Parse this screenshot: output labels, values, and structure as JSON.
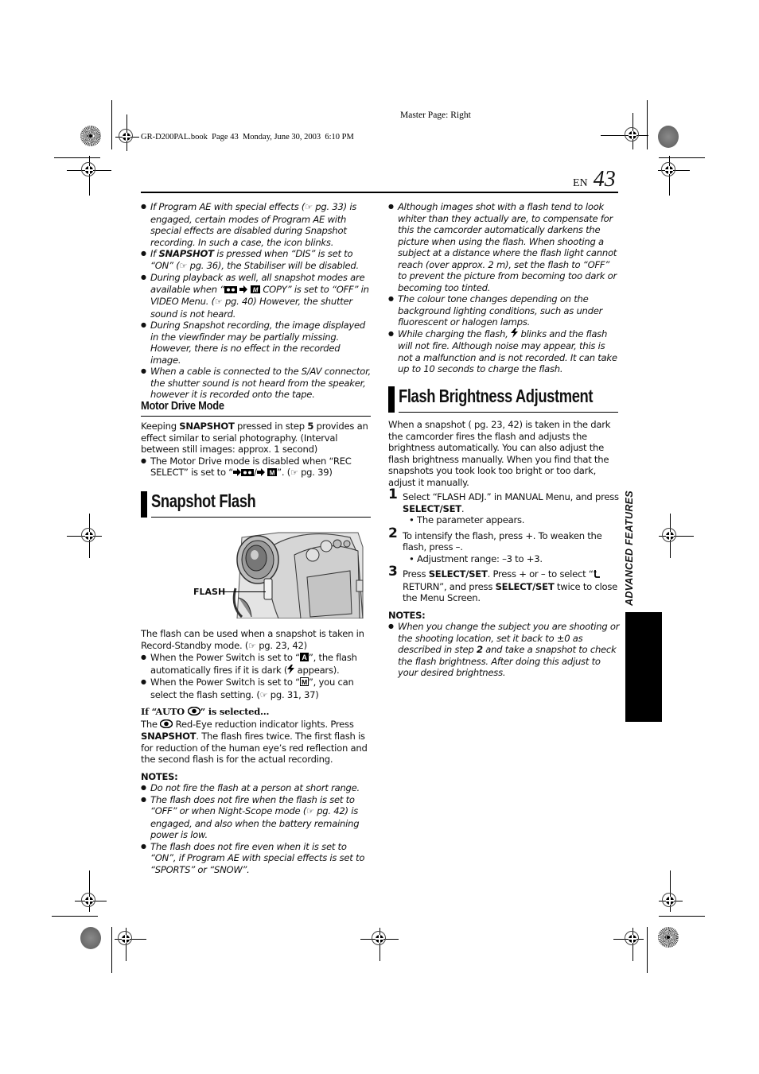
{
  "header": {
    "master_page": "Master Page: Right",
    "book_info": "GR-D200PAL.book  Page 43  Monday, June 30, 2003  6:10 PM",
    "lang": "EN",
    "page_number": "43"
  },
  "side_tab": {
    "label": "ADVANCED FEATURES"
  },
  "left_column": {
    "intro_bullets": [
      {
        "pre": "If Program AE with special effects (",
        "ref": "pg. 33) is engaged, certain modes of Program AE with special effects are disabled during Snapshot recording. In such a case, the icon blinks."
      },
      {
        "pre": "If ",
        "bold": "SNAPSHOT",
        "post": " is pressed when “DIS” is set to “ON” (",
        "ref": "pg. 36), the Stabiliser will be disabled."
      },
      {
        "pre": "During playback as well, all snapshot modes are available when “",
        "mid": " COPY” is set to “OFF” in VIDEO Menu. (",
        "ref": "pg. 40) However, the shutter sound is not heard."
      },
      {
        "text": "During Snapshot recording, the image displayed in the viewfinder may be partially missing. However, there is no effect in the recorded image."
      },
      {
        "text": "When a cable is connected to the S/AV connector, the shutter sound is not heard from the speaker, however it is recorded onto the tape."
      }
    ],
    "motor_drive": {
      "title": "Motor Drive Mode",
      "body_pre": "Keeping ",
      "body_bold": "SNAPSHOT",
      "body_mid": " pressed in step ",
      "body_step": "5",
      "body_post": " provides an effect similar to serial photography. (Interval between still images: approx. 1 second)",
      "bullet_pre": "The Motor Drive mode is disabled when “REC SELECT” is set to “",
      "bullet_post": "”. (",
      "bullet_ref": "pg. 39)"
    },
    "snapshot_flash": {
      "title": "Snapshot Flash",
      "figure_label": "FLASH",
      "body": "The flash can be used when a snapshot is taken in Record-Standby mode. (",
      "body_ref": "pg. 23, 42)",
      "bullet1_pre": "When the Power Switch is set to “",
      "bullet1_mid": "”, the flash automatically fires if it is dark (",
      "bullet1_post": " appears).",
      "bullet2_pre": "When the Power Switch is set to “",
      "bullet2_mid": "”, you can select the flash setting. (",
      "bullet2_ref": "pg. 31, 37)",
      "auto_heading_pre": "If “AUTO ",
      "auto_heading_post": "” is selected...",
      "auto_body_pre": "The ",
      "auto_body_mid": " Red-Eye reduction indicator lights. Press ",
      "auto_body_bold": "SNAPSHOT",
      "auto_body_post": ". The flash fires twice. The first flash is for reduction of the human eye’s red reflection and the second flash is for the actual recording.",
      "notes_title": "NOTES:",
      "notes": [
        {
          "text": "Do not fire the flash at a person at short range."
        },
        {
          "pre": "The flash does not fire when the flash is set to “OFF” or when Night-Scope mode (",
          "ref": "pg. 42) is engaged, and also when the battery remaining power is low."
        },
        {
          "text": "The flash does not fire even when it is set to “ON”, if Program AE with special effects is set to “SPORTS” or “SNOW”."
        }
      ]
    }
  },
  "right_column": {
    "bullets": [
      {
        "text": "Although images shot with a flash tend to look whiter than they actually are, to compensate for this the camcorder automatically darkens the picture when using the flash. When shooting a subject at a distance where the flash light cannot reach (over approx. 2 m), set the flash to “OFF” to prevent the picture from becoming too dark or becoming too tinted."
      },
      {
        "text": "The colour tone changes depending on the background lighting conditions, such as under fluorescent or halogen lamps."
      },
      {
        "pre": "While charging the flash, ",
        "post": " blinks and the flash will not fire. Although noise may appear, this is not a malfunction and is not recorded. It can take up to 10 seconds to charge the flash."
      }
    ],
    "flash_brightness": {
      "title": "Flash Brightness Adjustment",
      "intro": "When a snapshot ( pg. 23, 42) is taken in the dark the camcorder fires the flash and adjusts the brightness automatically. You can also adjust the flash brightness manually. When you find that the snapshots you took look too bright or too dark, adjust it manually.",
      "steps": [
        {
          "num": "1",
          "pre": "Select “FLASH ADJ.” in MANUAL Menu, and press ",
          "bold": "SELECT/SET",
          "post": ".",
          "sub": "• The parameter appears."
        },
        {
          "num": "2",
          "pre": "To intensify the flash, press +. To weaken the flash, press –.",
          "sub": "• Adjustment range: –3 to +3."
        },
        {
          "num": "3",
          "pre": "Press ",
          "bold": "SELECT/SET",
          "mid": ". Press + or – to select “",
          "mid2": "RETURN”, and press ",
          "bold2": "SELECT/SET",
          "post": " twice to close the Menu Screen."
        }
      ],
      "notes_title": "NOTES:",
      "note_pre": "When you change the subject you are shooting or the shooting location, set it back to ±0 as described in step ",
      "note_bold": "2",
      "note_post": " and take a snapshot to check the flash brightness. After doing this adjust to your desired brightness."
    }
  },
  "icons": {
    "ref_glyph": "☞",
    "return_glyph": "⮌"
  }
}
